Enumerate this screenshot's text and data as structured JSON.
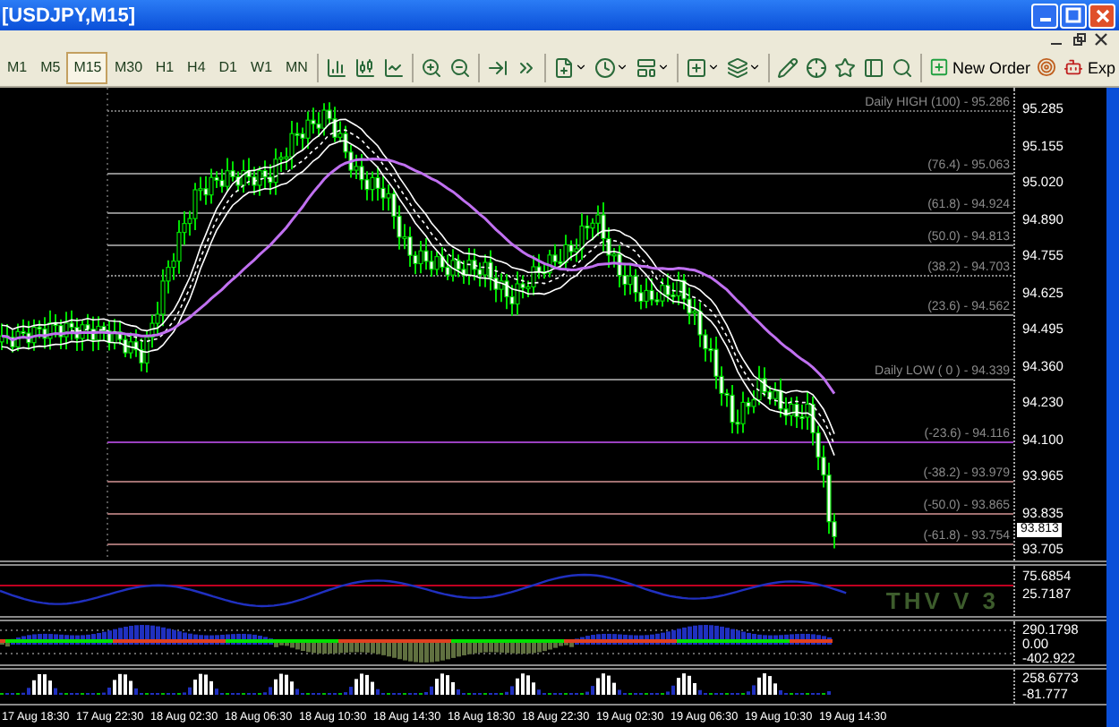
{
  "window": {
    "title": "[USDJPY,M15]"
  },
  "toolbar": {
    "timeframes": [
      {
        "label": "M1",
        "selected": false
      },
      {
        "label": "M5",
        "selected": false
      },
      {
        "label": "M15",
        "selected": true
      },
      {
        "label": "M30",
        "selected": false
      },
      {
        "label": "H1",
        "selected": false
      },
      {
        "label": "H4",
        "selected": false
      },
      {
        "label": "D1",
        "selected": false
      },
      {
        "label": "W1",
        "selected": false
      },
      {
        "label": "MN",
        "selected": false
      }
    ],
    "new_order": "New Order",
    "experts": "Exp"
  },
  "chart": {
    "price_axis": [
      "95.285",
      "95.155",
      "95.020",
      "94.890",
      "94.755",
      "94.625",
      "94.495",
      "94.360",
      "94.230",
      "94.100",
      "93.965",
      "93.835",
      "93.705"
    ],
    "fib_levels": [
      {
        "label": "Daily HIGH (100) - 95.286"
      },
      {
        "label": "(76.4) - 95.063"
      },
      {
        "label": "(61.8) - 94.924"
      },
      {
        "label": "(50.0) - 94.813"
      },
      {
        "label": "(38.2) - 94.703"
      },
      {
        "label": "(23.6) - 94.562"
      },
      {
        "label": "Daily LOW ( 0 ) - 94.339"
      },
      {
        "label": "(-23.6) - 94.116"
      },
      {
        "label": "(-38.2) - 93.979"
      },
      {
        "label": "(-50.0) - 93.865"
      },
      {
        "label": "(-61.8) - 93.754"
      }
    ],
    "current_price": "93.813"
  },
  "indicators": [
    {
      "title": "THV V 3",
      "axis": [
        "75.6854",
        "25.7187"
      ]
    },
    {
      "axis": [
        "290.1798",
        "0.00",
        "-402.922"
      ]
    },
    {
      "axis": [
        "258.6773",
        "-81.777"
      ]
    }
  ],
  "time_axis": [
    "17 Aug 18:30",
    "17 Aug 22:30",
    "18 Aug 02:30",
    "18 Aug 06:30",
    "18 Aug 10:30",
    "18 Aug 14:30",
    "18 Aug 18:30",
    "18 Aug 22:30",
    "19 Aug 02:30",
    "19 Aug 06:30",
    "19 Aug 10:30",
    "19 Aug 14:30"
  ]
}
